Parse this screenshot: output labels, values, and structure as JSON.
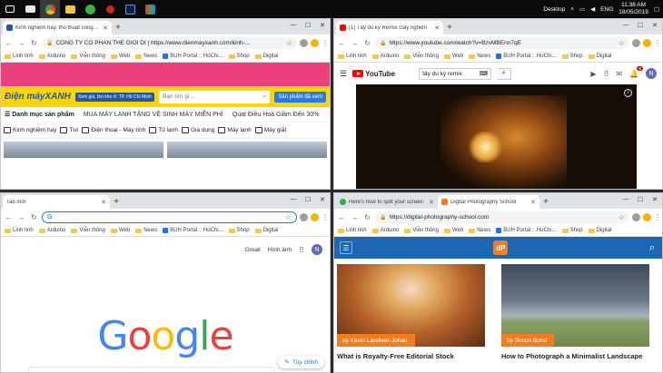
{
  "taskbar": {
    "desktop_label": "Desktop",
    "language": "ENG",
    "time": "11:38 AM",
    "date": "18/05/2019"
  },
  "windows": {
    "dmx": {
      "tabs": [
        {
          "title": "Kinh nghiệm hay, thủ thuật công nghệ"
        }
      ],
      "url": "CONG TY CO PHAN THE GIOI DI  |  https://www.dienmayxanh.com/kinh-...",
      "bookmarks": [
        "Linh tinh",
        "Arduino",
        "Viễn thông",
        "Web",
        "News",
        "BUH Portal :: HoChi...",
        "Shop",
        "Digital"
      ],
      "logo": "Điện máyXANH",
      "location": "Xem giá, tồn kho ở: TP. Hồ Chí Minh",
      "search_placeholder": "Bạn tìm gì...",
      "search_button": "Sản phẩm đã xem",
      "menu_label": "Danh mục sản phẩm",
      "promo": "MUA MÁY LẠNH TẶNG VỆ SINH MÁY MIỄN PHÍ",
      "promo2": "Quạt Điều Hoà Giảm Đến 30%",
      "categories": [
        "Kinh nghiệm hay",
        "Tivi",
        "Điện thoại - Máy tính",
        "Tủ lạnh",
        "Gia dụng",
        "Máy lạnh",
        "Máy giặt"
      ]
    },
    "yt": {
      "tabs": [
        {
          "title": "(1) Tây du ký Remix Gây nghiện"
        }
      ],
      "url": "https://www.youtube.com/watch?v=BzvMBEnn7qE",
      "bookmarks": [
        "Linh tinh",
        "Arduino",
        "Viễn thông",
        "Web",
        "News",
        "BUH Portal :: HoChi...",
        "Shop",
        "Digital"
      ],
      "logo_text": "YouTube",
      "search_value": "tây du ký remix",
      "notification_count": "6",
      "avatar": "N"
    },
    "newtab": {
      "tabs": [
        {
          "title": "Tab mới"
        }
      ],
      "url": "",
      "bookmarks": [
        "Linh tinh",
        "Arduino",
        "Viễn thông",
        "Web",
        "News",
        "BUH Portal :: HoChi...",
        "Shop",
        "Digital"
      ],
      "gmail": "Gmail",
      "images": "Hình ảnh",
      "avatar": "N",
      "customize": "Tùy chỉnh"
    },
    "dps": {
      "tabs": [
        {
          "title": "Here's how to split your screen"
        },
        {
          "title": "Digital Photography School"
        }
      ],
      "url": "https://digital-photography-school.com",
      "bookmarks": [
        "Linh tinh",
        "Arduino",
        "Viễn thông",
        "Web",
        "News",
        "BUH Portal :: HoChi...",
        "Shop",
        "Digital"
      ],
      "logo": "dP",
      "cards": [
        {
          "author": "by Kevin Landwer-Johan",
          "title": "What is Royalty-Free Editorial Stock"
        },
        {
          "author": "by Simon Bond",
          "title": "How to Photograph a Minimalist Landscape"
        }
      ]
    }
  }
}
